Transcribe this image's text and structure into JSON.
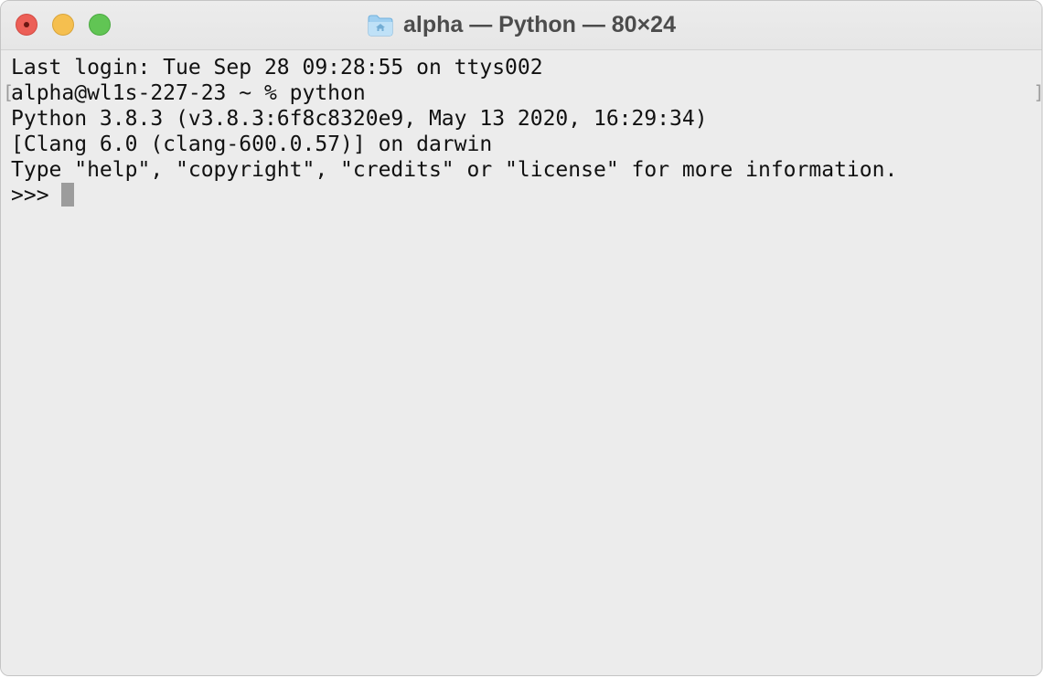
{
  "window": {
    "title": "alpha — Python — 80×24"
  },
  "terminal": {
    "lines": [
      "Last login: Tue Sep 28 09:28:55 on ttys002",
      "alpha@wl1s-227-23 ~ % python",
      "Python 3.8.3 (v3.8.3:6f8c8320e9, May 13 2020, 16:29:34)",
      "[Clang 6.0 (clang-600.0.57)] on darwin",
      "Type \"help\", \"copyright\", \"credits\" or \"license\" for more information.",
      ">>> "
    ],
    "left_bracket": "[",
    "right_bracket": "]"
  },
  "icons": {
    "close": "close-icon",
    "minimize": "minimize-icon",
    "zoom": "zoom-icon",
    "folder": "folder-icon",
    "cursor": "terminal-cursor"
  },
  "colors": {
    "close": "#ec5f57",
    "minimize": "#f5bf4f",
    "zoom": "#61c554",
    "background": "#ececec",
    "text": "#111111",
    "cursor": "#9c9c9c"
  }
}
